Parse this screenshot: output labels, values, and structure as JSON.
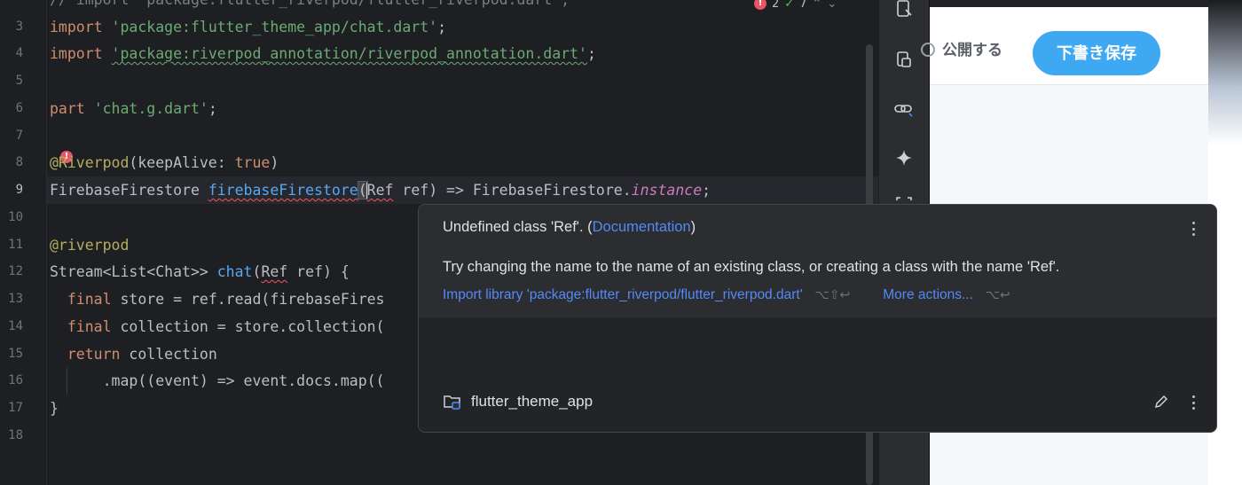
{
  "editor": {
    "line_numbers": [
      "3",
      "4",
      "5",
      "6",
      "7",
      "8",
      "9",
      "10",
      "11",
      "12",
      "13",
      "14",
      "15",
      "16",
      "17",
      "18"
    ],
    "current_line": "9",
    "lines": {
      "l2": "// import 'package:flutter_riverpod/flutter_riverpod.dart';",
      "l3_kw": "import",
      "l3_str": "'package:flutter_theme_app/chat.dart'",
      "l3_end": ";",
      "l4_kw": "import",
      "l4_str": "'package:riverpod_annotation/riverpod_annotation.dart'",
      "l4_end": ";",
      "l6_kw": "part",
      "l6_str": "'chat.g.dart'",
      "l6_end": ";",
      "l8_ann": "@Riverpod",
      "l8_rest": "(keepAlive: ",
      "l8_kw": "true",
      "l8_end": ")",
      "l9_type": "FirebaseFirestore ",
      "l9_fn": "firebaseFirestore",
      "l9_paren": "(",
      "l9_ref": "Ref",
      "l9_args": " ref) => FirebaseFirestore.",
      "l9_it": "instance",
      "l9_end": ";",
      "l11_ann": "@riverpod",
      "l12_a": "Stream<List<Chat>> ",
      "l12_fn": "chat",
      "l12_b": "(",
      "l12_ref": "Ref",
      "l12_c": " ref) {",
      "l13_kw": "final",
      "l13_rest": " store = ref.read(firebaseFires",
      "l14_kw": "final",
      "l14_rest": " collection = store.collection(",
      "l15_kw": "return",
      "l15_rest": " collection",
      "l16": ".map((event) => event.docs.map((",
      "l17": "}"
    },
    "inspections": {
      "errors": "2",
      "ok": "7"
    }
  },
  "browser": {
    "publish_label": "公開する",
    "save_draft_label": "下書き保存"
  },
  "popup": {
    "title_prefix": "Undefined class 'Ref'. (",
    "title_link": "Documentation",
    "title_suffix": ")",
    "description": "Try changing the name to the name of an existing class, or creating a class with the name 'Ref'.",
    "import_action": "Import library 'package:flutter_riverpod/flutter_riverpod.dart'",
    "import_shortcut": "⌥⇧↩",
    "more_actions": "More actions...",
    "more_shortcut": "⌥↩",
    "project_name": "flutter_theme_app"
  },
  "colors": {
    "accent_blue": "#548af7",
    "error_red": "#f75464",
    "save_button": "#3ea8f3"
  }
}
